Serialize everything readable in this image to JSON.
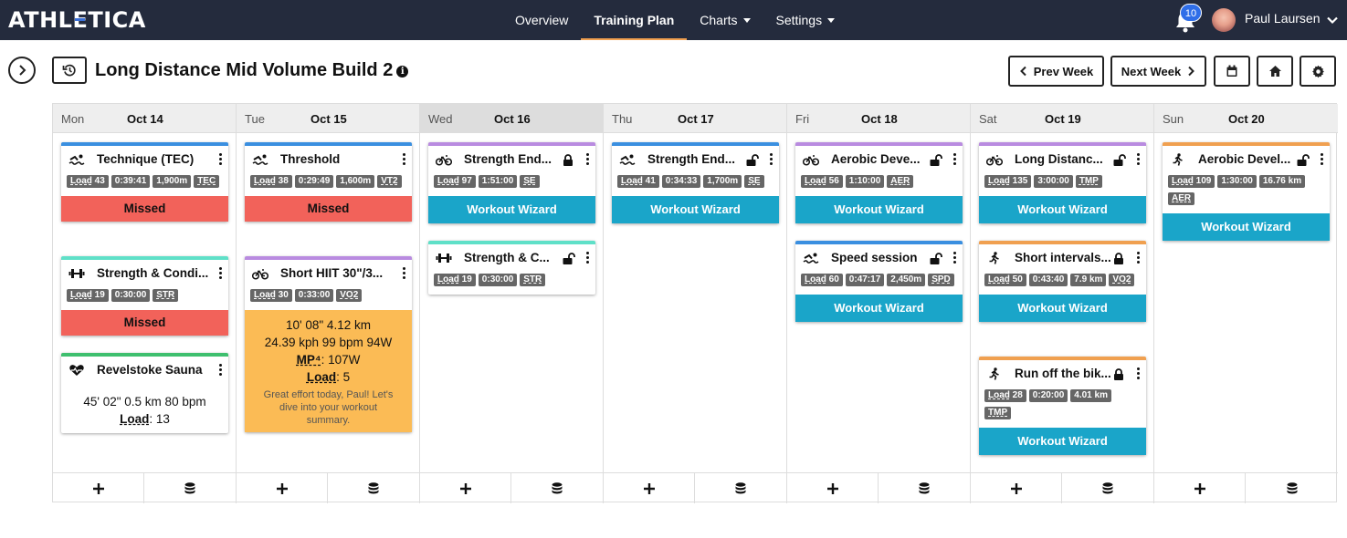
{
  "app": {
    "logo_text": "ATHLETICA"
  },
  "nav": {
    "links": [
      {
        "label": "Overview"
      },
      {
        "label": "Training Plan",
        "active": true
      },
      {
        "label": "Charts",
        "dropdown": true
      },
      {
        "label": "Settings",
        "dropdown": true
      }
    ],
    "notification_count": "10",
    "user_name": "Paul Laursen"
  },
  "toolbar": {
    "plan_title": "Long Distance Mid Volume Build 2",
    "info_glyph": "i",
    "prev_week": "Prev Week",
    "next_week": "Next Week"
  },
  "colors": {
    "swim": "#3a8fe0",
    "strength": "#5fe0c8",
    "bike": "#b98be0",
    "run": "#f0a050",
    "health": "#3ebf6e",
    "missed": "#f2625a",
    "wizard": "#1aa5c9",
    "summary": "#fbbb55"
  },
  "days": [
    {
      "dow": "Mon",
      "date": "Oct 14",
      "cards": [
        {
          "title": "Technique (TEC)",
          "icon": "swim-icon",
          "type": "swim",
          "tags": [
            "Load 43",
            "0:39:41",
            "1,900m",
            "TEC"
          ],
          "status": "Missed"
        },
        {
          "title": "Strength & Condi...",
          "icon": "dumbbell-icon",
          "type": "strength",
          "tags": [
            "Load 19",
            "0:30:00",
            "STR"
          ],
          "status": "Missed"
        },
        {
          "title": "Revelstoke Sauna",
          "icon": "heart-pulse-icon",
          "type": "health",
          "summary": [
            "45' 02\"   0.5 km   80 bpm"
          ],
          "summary_load_label": "Load",
          "summary_load_value": ": 13"
        }
      ]
    },
    {
      "dow": "Tue",
      "date": "Oct 15",
      "cards": [
        {
          "title": "Threshold",
          "icon": "swim-icon",
          "type": "swim",
          "tags": [
            "Load 38",
            "0:29:49",
            "1,600m",
            "VT2"
          ],
          "status": "Missed"
        },
        {
          "title": "Short HIIT 30\"/3...",
          "icon": "bike-icon",
          "type": "bike",
          "tags": [
            "Load 30",
            "0:33:00",
            "VO2"
          ],
          "summary": [
            "10' 08\"   4.12 km",
            "24.39 kph   99 bpm   94W"
          ],
          "summary_mp_label": "MP⁴",
          "summary_mp_value": ": 107W",
          "summary_load_label": "Load",
          "summary_load_value": ": 5",
          "note": "Great effort today, Paul! Let's dive into your workout summary."
        }
      ]
    },
    {
      "dow": "Wed",
      "date": "Oct 16",
      "today": true,
      "cards": [
        {
          "title": "Strength End...",
          "icon": "bike-icon",
          "type": "bike",
          "lock": "closed",
          "tags": [
            "Load 97",
            "1:51:00",
            "SE"
          ],
          "status": "Workout Wizard"
        },
        {
          "title": "Strength & C...",
          "icon": "dumbbell-icon",
          "type": "strength",
          "lock": "open",
          "tags": [
            "Load 19",
            "0:30:00",
            "STR"
          ]
        }
      ]
    },
    {
      "dow": "Thu",
      "date": "Oct 17",
      "cards": [
        {
          "title": "Strength End...",
          "icon": "swim-icon",
          "type": "swim",
          "lock": "open",
          "tags": [
            "Load 41",
            "0:34:33",
            "1,700m",
            "SE"
          ],
          "status": "Workout Wizard"
        }
      ]
    },
    {
      "dow": "Fri",
      "date": "Oct 18",
      "cards": [
        {
          "title": "Aerobic Deve...",
          "icon": "bike-icon",
          "type": "bike",
          "lock": "open",
          "tags": [
            "Load 56",
            "1:10:00",
            "AER"
          ],
          "status": "Workout Wizard"
        },
        {
          "title": "Speed session",
          "icon": "swim-icon",
          "type": "swim",
          "lock": "open",
          "tags": [
            "Load 60",
            "0:47:17",
            "2,450m",
            "SPD"
          ],
          "status": "Workout Wizard"
        }
      ]
    },
    {
      "dow": "Sat",
      "date": "Oct 19",
      "cards": [
        {
          "title": "Long Distanc...",
          "icon": "bike-icon",
          "type": "bike",
          "lock": "open",
          "tags": [
            "Load 135",
            "3:00:00",
            "TMP"
          ],
          "status": "Workout Wizard"
        },
        {
          "title": "Short intervals...",
          "icon": "run-icon",
          "type": "run",
          "lock": "closed",
          "tags": [
            "Load 50",
            "0:43:40",
            "7.9 km",
            "VO2"
          ],
          "status": "Workout Wizard"
        },
        {
          "title": "Run off the bik...",
          "icon": "run-icon",
          "type": "run",
          "lock": "closed",
          "tags": [
            "Load 28",
            "0:20:00",
            "4.01 km",
            "TMP"
          ],
          "status": "Workout Wizard"
        }
      ]
    },
    {
      "dow": "Sun",
      "date": "Oct 20",
      "cards": [
        {
          "title": "Aerobic Devel...",
          "icon": "run-icon",
          "type": "run",
          "lock": "open",
          "tags": [
            "Load 109",
            "1:30:00",
            "16.76 km",
            "AER"
          ],
          "status": "Workout Wizard"
        }
      ]
    }
  ],
  "footer": {
    "add_glyph": "+",
    "library_icon": "database-icon"
  }
}
